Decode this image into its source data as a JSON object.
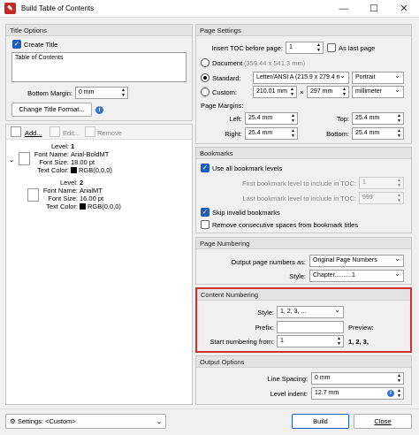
{
  "window": {
    "title": "Build Table of Contents",
    "minimize": "—",
    "maximize": "☐",
    "close": "✕"
  },
  "title_options": {
    "header": "Title Options",
    "create_title_label": "Create Title",
    "create_title_checked": true,
    "title_text": "Table of Contents",
    "bottom_margin_label": "Bottom Margin:",
    "bottom_margin_value": "0 mm",
    "change_font_button": "Change Title Format..."
  },
  "level_toolbar": {
    "add": "Add...",
    "edit": "Edit...",
    "remove": "Remove"
  },
  "levels": [
    {
      "level_label": "Level:",
      "level": "1",
      "font_name_label": "Font Name:",
      "font_name": "Arial-BoldMT",
      "font_size_label": "Font Size:",
      "font_size": "18.00 pt",
      "text_color_label": "Text Color:",
      "text_color": "RGB(0,0,0)"
    },
    {
      "level_label": "Level:",
      "level": "2",
      "font_name_label": "Font Name:",
      "font_name": "ArialMT",
      "font_size_label": "Font Size:",
      "font_size": "16.00 pt",
      "text_color_label": "Text Color:",
      "text_color": "RGB(0,0,0)"
    }
  ],
  "page_settings": {
    "header": "Page Settings",
    "insert_toc_label": "Insert TOC before page:",
    "insert_toc_value": "1",
    "as_last_page": "As last page",
    "document_label": "Document",
    "document_size": "(359.44 x 541.3 mm)",
    "standard_label": "Standard:",
    "standard_value": "Letter/ANSI A (215.9 x 279.4 n",
    "orientation": "Portrait",
    "custom_label": "Custom:",
    "custom_w": "210.01 mm",
    "times": "×",
    "custom_h": "297 mm",
    "units": "millimeter",
    "margins_label": "Page Margins:",
    "left_label": "Left:",
    "left": "25.4 mm",
    "top_label": "Top:",
    "top": "25.4 mm",
    "right_label": "Right:",
    "right": "25.4 mm",
    "bottom_label": "Bottom:",
    "bottom": "25.4 mm"
  },
  "bookmarks": {
    "header": "Bookmarks",
    "use_all": "Use all bookmark levels",
    "first_label": "First bookmark level to include in TOC:",
    "first_value": "1",
    "last_label": "Last bookmark level to include in TOC:",
    "last_value": "999",
    "skip_invalid": "Skip invalid bookmarks",
    "remove_spaces": "Remove consecutive spaces from bookmark titles"
  },
  "page_numbering": {
    "header": "Page Numbering",
    "output_label": "Output page numbers as:",
    "output_value": "Original Page Numbers",
    "style_label": "Style:",
    "style_value": "Chapter..........1"
  },
  "content_numbering": {
    "header": "Content Numbering",
    "style_label": "Style:",
    "style_value": "1, 2, 3, ...",
    "prefix_label": "Prefix:",
    "prefix_value": "",
    "preview_label": "Preview:",
    "start_label": "Start numbering from:",
    "start_value": "1",
    "preview_value": "1, 2, 3,",
    "highlight_color": "#d32f2f"
  },
  "output_options": {
    "header": "Output Options",
    "line_spacing_label": "Line Spacing:",
    "line_spacing": "0 mm",
    "level_indent_label": "Level indent:",
    "level_indent": "12.7 mm"
  },
  "footer": {
    "settings": "Settings: <Custom>",
    "build": "Build",
    "close": "Close"
  }
}
